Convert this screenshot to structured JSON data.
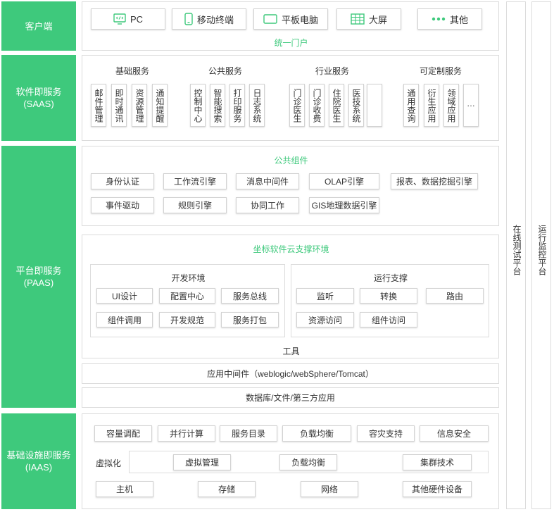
{
  "colors": {
    "accent": "#3ec97c",
    "border": "#dcdcdc",
    "text": "#333333"
  },
  "layers": {
    "client": "客户端",
    "saas": [
      "软件即服务",
      "(SAAS)"
    ],
    "paas": [
      "平台即服务",
      "(PAAS)"
    ],
    "iaas": [
      "基础设施即服务",
      "(IAAS)"
    ]
  },
  "client": {
    "items": [
      {
        "label": "PC",
        "icon": "pc-icon"
      },
      {
        "label": "移动终端",
        "icon": "mobile-icon"
      },
      {
        "label": "平板电脑",
        "icon": "tablet-icon"
      },
      {
        "label": "大屏",
        "icon": "big-screen-icon"
      },
      {
        "label": "其他",
        "icon": "more-dots-icon"
      }
    ],
    "portal": "统一门户"
  },
  "saas": {
    "groups": [
      {
        "title": "基础服务",
        "items": [
          "邮件管理",
          "即时通讯",
          "资源管理",
          "通知提醒"
        ]
      },
      {
        "title": "公共服务",
        "items": [
          "控制中心",
          "智能搜索",
          "打印服务",
          "日志系统"
        ]
      },
      {
        "title": "行业服务",
        "items": [
          "门诊医生",
          "门诊收费",
          "住院医生",
          "医技系统",
          ""
        ]
      },
      {
        "title": "可定制服务",
        "items": [
          "通用查询",
          "衍生应用",
          "领域应用",
          "…"
        ]
      }
    ]
  },
  "paas": {
    "components_title": "公共组件",
    "components_row1": [
      "身份认证",
      "工作流引擎",
      "消息中间件",
      "OLAP引擎",
      "报表、数据挖掘引擎"
    ],
    "components_row2": [
      "事件驱动",
      "规则引擎",
      "协同工作",
      "GIS地理数据引擎"
    ],
    "env_title": "坐标软件云支撑环境",
    "dev": {
      "title": "开发环境",
      "items": [
        "UI设计",
        "配置中心",
        "服务总线",
        "组件调用",
        "开发规范",
        "服务打包"
      ]
    },
    "runtime": {
      "title": "运行支撑",
      "items": [
        "监听",
        "转换",
        "路由",
        "资源访问",
        "组件访问"
      ]
    },
    "tools": "工具",
    "middleware": "应用中间件（weblogic/webSphere/Tomcat）",
    "storage": "数据库/文件/第三方应用"
  },
  "iaas": {
    "row1": [
      "容量调配",
      "并行计算",
      "服务目录",
      "负载均衡",
      "容灾支持",
      "信息安全"
    ],
    "virt_label": "虚拟化",
    "virt_items": [
      "虚拟管理",
      "负载均衡",
      "集群技术"
    ],
    "row3": [
      "主机",
      "存储",
      "网络",
      "其他硬件设备"
    ]
  },
  "side": {
    "online_test": "在线测试平台",
    "ops_monitor": "运行监控平台"
  }
}
